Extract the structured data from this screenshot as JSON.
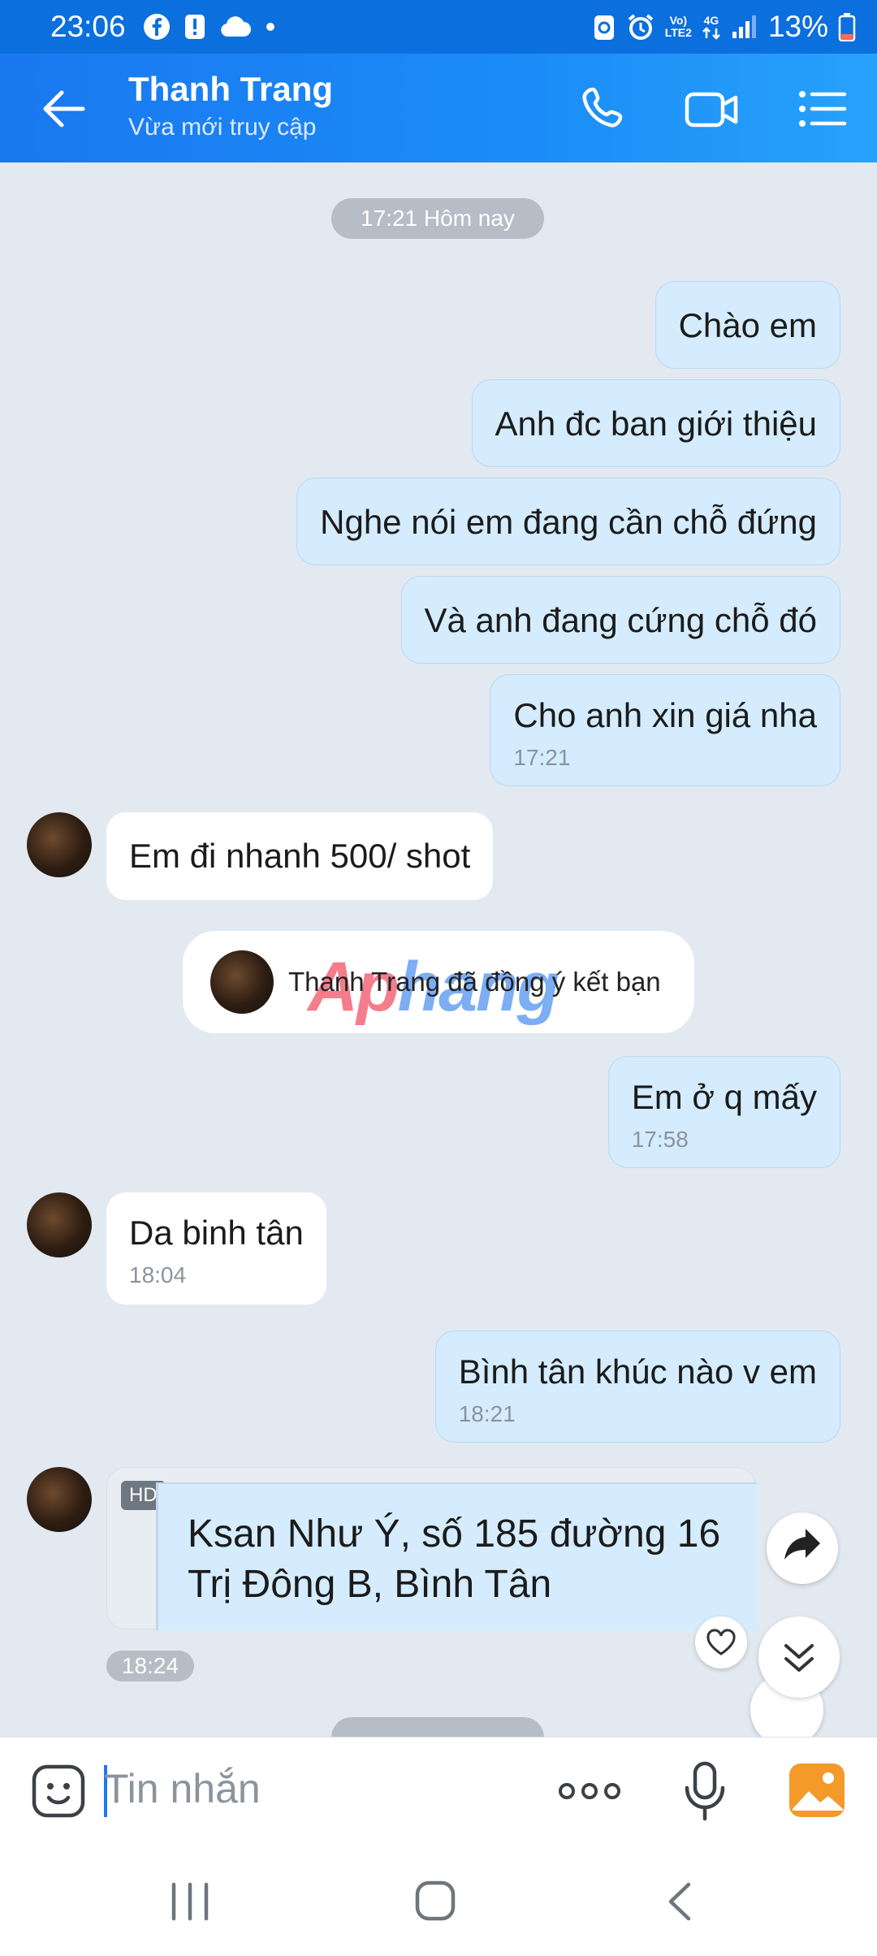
{
  "status_bar": {
    "time": "23:06",
    "battery": "13%",
    "net_top": "Vo)",
    "net_bottom": "LTE2",
    "gen": "4G"
  },
  "header": {
    "contact_name": "Thanh Trang",
    "status": "Vừa mới truy cập"
  },
  "chat": {
    "date_pill": "17:21 Hôm nay",
    "messages": [
      {
        "dir": "out",
        "text": "Chào em"
      },
      {
        "dir": "out",
        "text": "Anh đc ban giới thiệu"
      },
      {
        "dir": "out",
        "text": "Nghe nói em đang cần chỗ đứng"
      },
      {
        "dir": "out",
        "text": "Và anh đang cứng chỗ đó"
      },
      {
        "dir": "out",
        "text": "Cho anh xin giá nha",
        "time": "17:21"
      },
      {
        "dir": "in",
        "text": "Em đi nhanh 500/ shot"
      },
      {
        "dir": "out",
        "text": "Em ở q mấy",
        "time": "17:58"
      },
      {
        "dir": "in",
        "text": "Da binh tân",
        "time": "18:04"
      },
      {
        "dir": "out",
        "text": "Bình tân khúc nào v em",
        "time": "18:21"
      }
    ],
    "friend_notice": "Thanh Trang đã đồng ý kết bạn",
    "watermark": {
      "part1": "Ap",
      "part2": "hang"
    },
    "quoted_message": {
      "badge": "HD",
      "line1": "Ksan Như Ý, số 185 đường 16",
      "line2": "Trị Đông B, Bình Tân",
      "time": "18:24"
    }
  },
  "input": {
    "placeholder": "Tin nhắn"
  },
  "colors": {
    "header_start": "#1a78f0",
    "header_end": "#27a2fb",
    "outgoing_bubble": "#d4ecfd",
    "incoming_bubble": "#ffffff",
    "chat_background": "#e2e9f1",
    "accent_orange": "#f39a2a"
  }
}
